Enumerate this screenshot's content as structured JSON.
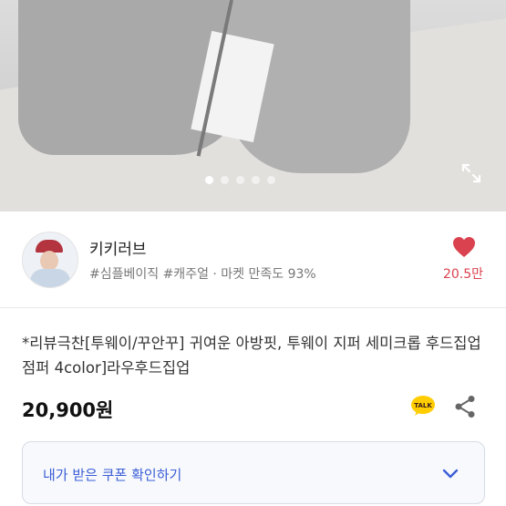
{
  "gallery": {
    "dot_count": 5,
    "active_index": 0
  },
  "seller": {
    "name": "키키러브",
    "tags": "#심플베이직 #캐주얼 · 마켓 만족도 93%",
    "likes": "20.5만"
  },
  "product": {
    "title": "*리뷰극찬[투웨이/꾸안꾸] 귀여운 아방핏, 투웨이 지퍼 세미크롭 후드집업 점퍼 4color]라우후드집업",
    "price": "20,900원"
  },
  "talk_icon_label": "TALK",
  "coupon": {
    "label": "내가 받은 쿠폰 확인하기"
  },
  "colors": {
    "accent": "#3b5ed6",
    "like": "#d9424e",
    "talk": "#ffcd00"
  }
}
